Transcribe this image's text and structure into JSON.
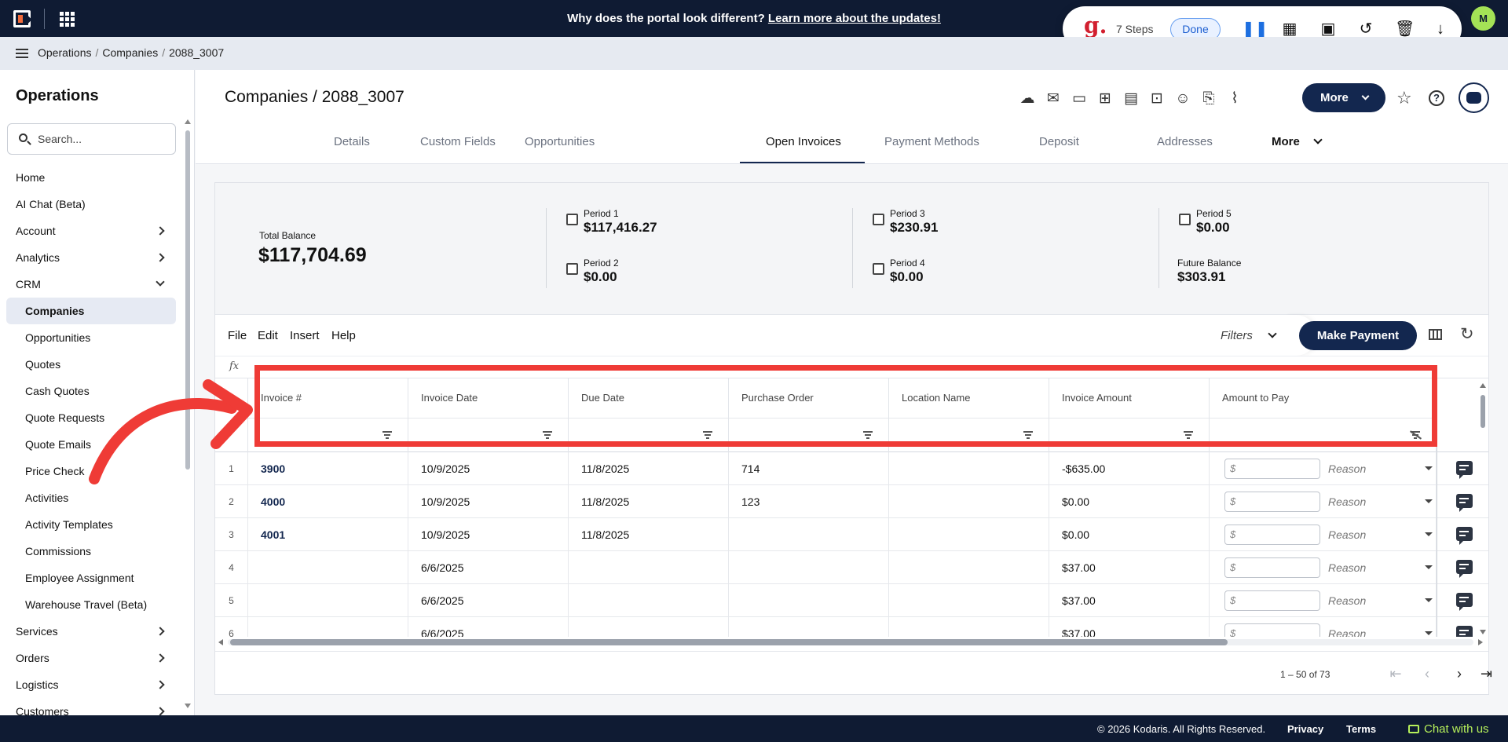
{
  "banner": {
    "text": "Why does the portal look different? ",
    "link": "Learn more about the updates!"
  },
  "recorder": {
    "logo": "g.",
    "steps": "7 Steps",
    "done": "Done"
  },
  "user": {
    "initial": "M"
  },
  "breadcrumb": [
    "Operations",
    "Companies",
    "2088_3007"
  ],
  "sidebar": {
    "title": "Operations",
    "search_placeholder": "Search...",
    "items": [
      {
        "label": "Home",
        "chevron": ""
      },
      {
        "label": "AI Chat (Beta)",
        "chevron": ""
      },
      {
        "label": "Account",
        "chevron": "right"
      },
      {
        "label": "Analytics",
        "chevron": "right"
      },
      {
        "label": "CRM",
        "chevron": "down"
      },
      {
        "label": "Companies",
        "sub": true,
        "active": true
      },
      {
        "label": "Opportunities",
        "sub": true
      },
      {
        "label": "Quotes",
        "sub": true
      },
      {
        "label": "Cash Quotes",
        "sub": true
      },
      {
        "label": "Quote Requests",
        "sub": true
      },
      {
        "label": "Quote Emails",
        "sub": true
      },
      {
        "label": "Price Check",
        "sub": true
      },
      {
        "label": "Activities",
        "sub": true
      },
      {
        "label": "Activity Templates",
        "sub": true
      },
      {
        "label": "Commissions",
        "sub": true
      },
      {
        "label": "Employee Assignment",
        "sub": true
      },
      {
        "label": "Warehouse Travel (Beta)",
        "sub": true
      },
      {
        "label": "Services",
        "chevron": "right"
      },
      {
        "label": "Orders",
        "chevron": "right"
      },
      {
        "label": "Logistics",
        "chevron": "right"
      },
      {
        "label": "Customers",
        "chevron": "right"
      }
    ]
  },
  "header": {
    "title": "Companies / 2088_3007",
    "more": "More",
    "tabs": [
      "Details",
      "Custom Fields",
      "Opportunities",
      "Open Invoices",
      "Payment Methods",
      "Deposit",
      "Addresses"
    ],
    "active_tab": "Open Invoices",
    "tabs_more": "More"
  },
  "summary": {
    "total_label": "Total Balance",
    "total_value": "$117,704.69",
    "periods": [
      {
        "label": "Period 1",
        "value": "$117,416.27"
      },
      {
        "label": "Period 2",
        "value": "$0.00"
      },
      {
        "label": "Period 3",
        "value": "$230.91"
      },
      {
        "label": "Period 4",
        "value": "$0.00"
      },
      {
        "label": "Period 5",
        "value": "$0.00"
      },
      {
        "label": "Future Balance",
        "value": "$303.91"
      }
    ]
  },
  "toolbar": {
    "menus": [
      "File",
      "Edit",
      "Insert",
      "Help"
    ],
    "filters": "Filters",
    "make_payment": "Make Payment",
    "fx": "fx"
  },
  "table": {
    "columns": [
      "Invoice #",
      "Invoice Date",
      "Due Date",
      "Purchase Order",
      "Location Name",
      "Invoice Amount",
      "Amount to Pay"
    ],
    "amount_placeholder": "$",
    "reason_placeholder": "Reason",
    "rows": [
      {
        "n": "1",
        "invoice": "3900",
        "date": "10/9/2025",
        "due": "11/8/2025",
        "po": "714",
        "loc": "",
        "amount": "-$635.00"
      },
      {
        "n": "2",
        "invoice": "4000",
        "date": "10/9/2025",
        "due": "11/8/2025",
        "po": "123",
        "loc": "",
        "amount": "$0.00"
      },
      {
        "n": "3",
        "invoice": "4001",
        "date": "10/9/2025",
        "due": "11/8/2025",
        "po": "",
        "loc": "",
        "amount": "$0.00"
      },
      {
        "n": "4",
        "invoice": "",
        "date": "6/6/2025",
        "due": "",
        "po": "",
        "loc": "",
        "amount": "$37.00"
      },
      {
        "n": "5",
        "invoice": "",
        "date": "6/6/2025",
        "due": "",
        "po": "",
        "loc": "",
        "amount": "$37.00"
      },
      {
        "n": "6",
        "invoice": "",
        "date": "6/6/2025",
        "due": "",
        "po": "",
        "loc": "",
        "amount": "$37.00"
      }
    ]
  },
  "pager": {
    "range": "1 – 50 of 73"
  },
  "footer": {
    "copyright": "© 2026 Kodaris. All Rights Reserved.",
    "privacy": "Privacy",
    "terms": "Terms",
    "chat": "Chat with us"
  },
  "colors": {
    "navy": "#13274f",
    "topbar": "#0f1b33",
    "highlight": "#ef3b36",
    "chat_green": "#b6f05a"
  }
}
